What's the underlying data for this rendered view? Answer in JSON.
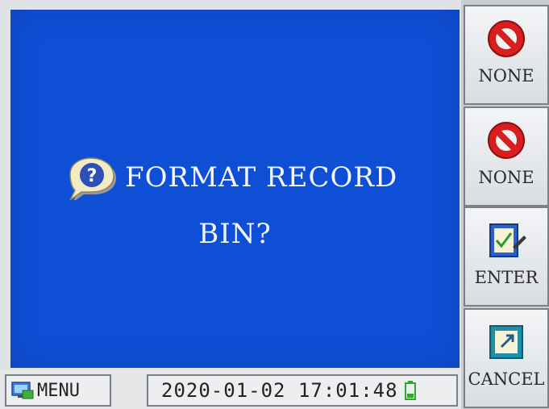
{
  "dialog": {
    "question_line1": "FORMAT RECORD",
    "question_line2": "BIN?",
    "icon": "question-bubble-icon"
  },
  "softkeys": [
    {
      "label": "NONE",
      "icon": "prohibited-icon"
    },
    {
      "label": "NONE",
      "icon": "prohibited-icon"
    },
    {
      "label": "ENTER",
      "icon": "confirm-icon"
    },
    {
      "label": "CANCEL",
      "icon": "cancel-icon"
    }
  ],
  "statusbar": {
    "menu_label": "MENU",
    "menu_icon": "menu-icon",
    "datetime": "2020-01-02 17:01:48",
    "battery_icon": "battery-icon"
  },
  "colors": {
    "dialog_background": "#0f4fd6",
    "text": "#f4f6ff",
    "prohibited": "#d81e1e"
  }
}
